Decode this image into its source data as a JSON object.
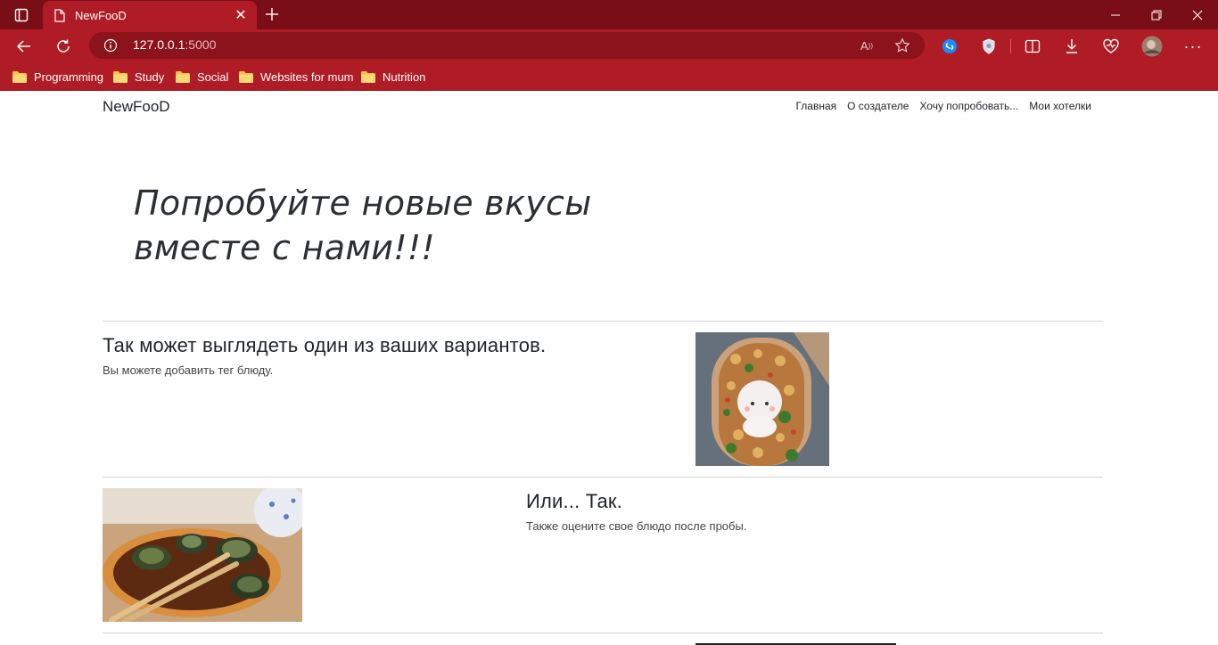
{
  "browser": {
    "tab_title": "NewFooD",
    "url_host": "127.0.0.1",
    "url_port": ":5000",
    "bookmarks": [
      "Programming",
      "Study",
      "Social",
      "Websites for mum",
      "Nutrition"
    ]
  },
  "site": {
    "brand": "NewFooD",
    "nav": [
      "Главная",
      "О создателе",
      "Хочу попробовать...",
      "Мои хотелки"
    ],
    "hero_line1": "Попробуйте новые вкусы",
    "hero_line2": "вместе с нами!!!",
    "features": [
      {
        "title": "Так может выглядеть один из ваших вариантов.",
        "text": "Вы можете добавить тег блюду."
      },
      {
        "title": "Или... Так.",
        "text": "Также оцените свое блюдо после пробы."
      }
    ]
  },
  "colors": {
    "chrome_dark": "#7a0e17",
    "chrome_main": "#b01c25",
    "omnibox": "#8c121b"
  }
}
